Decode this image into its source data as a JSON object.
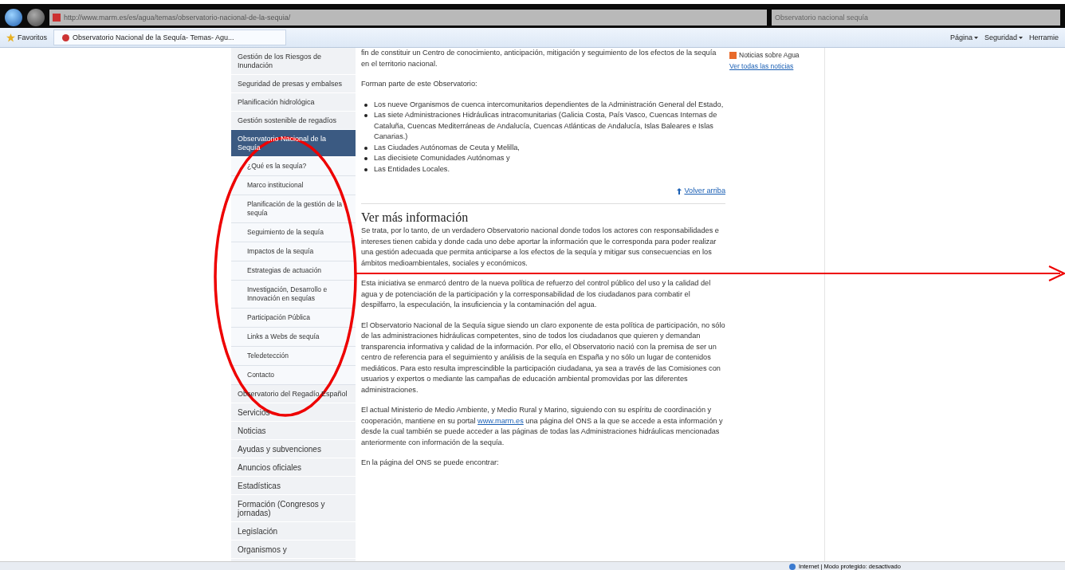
{
  "browser": {
    "address": "http://www.marm.es/es/agua/temas/observatorio-nacional-de-la-sequia/",
    "search_value": "Observatorio nacional sequía",
    "favorites": "Favoritos",
    "tab_title": "Observatorio Nacional de la Sequía- Temas- Agu...",
    "commands": [
      {
        "label": "Página",
        "dropdown": true
      },
      {
        "label": "Seguridad",
        "dropdown": true
      },
      {
        "label": "Herramie",
        "dropdown": false
      }
    ]
  },
  "sidebar": {
    "items": [
      {
        "label": "Gestión de los Riesgos de Inundación",
        "selected": false
      },
      {
        "label": "Seguridad de presas y embalses",
        "selected": false
      },
      {
        "label": "Planificación hidrológica",
        "selected": false
      },
      {
        "label": "Gestión sostenible de regadíos",
        "selected": false
      },
      {
        "label": "Observatorio Nacional de la Sequía",
        "selected": true,
        "children": [
          {
            "label": "¿Qué es la sequía?"
          },
          {
            "label": "Marco institucional"
          },
          {
            "label": "Planificación de la gestión de la sequía"
          },
          {
            "label": "Seguimiento de la sequía"
          },
          {
            "label": "Impactos de la sequía"
          },
          {
            "label": "Estrategias de actuación"
          },
          {
            "label": "Investigación, Desarrollo e Innovación en sequías"
          },
          {
            "label": "Participación Pública"
          },
          {
            "label": "Links a Webs de sequía"
          },
          {
            "label": "Teledetección"
          },
          {
            "label": "Contacto"
          }
        ]
      },
      {
        "label": "Observatorio del Regadío Español",
        "selected": false
      },
      {
        "label": "Servicios",
        "selected": false
      },
      {
        "label": "Noticias",
        "selected": false
      },
      {
        "label": "Ayudas y subvenciones",
        "selected": false
      },
      {
        "label": "Anuncios oficiales",
        "selected": false
      },
      {
        "label": "Estadísticas",
        "selected": false
      },
      {
        "label": "Formación (Congresos y jornadas)",
        "selected": false
      },
      {
        "label": "Legislación",
        "selected": false
      },
      {
        "label": "Organismos y",
        "selected": false
      }
    ]
  },
  "content": {
    "intro": "fin de constituir un Centro de conocimiento, anticipación, mitigación y seguimiento de los efectos de la sequía en el territorio nacional.",
    "members_intro": "Forman parte de este Observatorio:",
    "members": [
      "Los nueve Organismos de cuenca intercomunitarios dependientes de la Administración General del Estado,",
      "Las siete Administraciones Hidráulicas intracomunitarias (Galicia Costa, País Vasco, Cuencas Internas de Cataluña, Cuencas Mediterráneas de Andalucía, Cuencas Atlánticas de Andalucía, Islas Baleares e Islas Canarias.)",
      "Las Ciudades Autónomas de Ceuta y Melilla,",
      "Las diecisiete Comunidades Autónomas y",
      "Las Entidades Locales."
    ],
    "back_to_top": "Volver arriba",
    "heading": "Ver más información",
    "paragraphs": [
      [
        {
          "text": "Se trata, por lo tanto, de un verdadero Observatorio nacional donde todos los actores con responsabilidades e intereses tienen cabida y donde cada uno debe aportar la información que le corresponda para poder realizar una gestión adecuada que permita anticiparse a los efectos de la sequía y mitigar sus consecuencias en los ámbitos medioambientales, sociales y económicos."
        }
      ],
      [
        {
          "text": "Esta iniciativa se enmarcó dentro de la nueva política de refuerzo del control público del uso y la calidad del agua y de potenciación de la participación y la corresponsabilidad de los ciudadanos para combatir el despilfarro, la especulación, la insuficiencia y la contaminación del agua."
        }
      ],
      [
        {
          "text": "El Observatorio Nacional de la Sequía sigue siendo un claro exponente de esta política de participación, no sólo de las administraciones hidráulicas competentes, sino de todos los ciudadanos que quieren y demandan transparencia informativa y calidad de la información. Por ello, el Observatorio nació con la premisa de ser un centro de referencia para el seguimiento y análisis de la sequía en España y no sólo un lugar de contenidos mediáticos. Para esto resulta imprescindible la participación ciudadana, ya sea a través de las Comisiones con usuarios y expertos o mediante las campañas de educación ambiental promovidas por las diferentes administraciones."
        }
      ],
      [
        {
          "text": "El actual Ministerio de Medio Ambiente, y Medio Rural y Marino, siguiendo con su espíritu de coordinación y cooperación, mantiene en su portal "
        },
        {
          "text": "www.marm.es",
          "kind": "link"
        },
        {
          "text": " una página del ONS a la que se accede a esta información y desde la cual también se puede acceder a las páginas de todas las Administraciones hidráulicas mencionadas anteriormente con información de la sequía."
        }
      ],
      [
        {
          "text": "En la página del ONS se puede encontrar:"
        }
      ]
    ]
  },
  "news": {
    "feed": "Noticias sobre Agua",
    "all_link": "Ver todas las noticias"
  },
  "status_bar": {
    "zone": "Internet | Modo protegido: desactivado"
  },
  "annotations": {
    "ellipse": true,
    "arrow": true
  }
}
